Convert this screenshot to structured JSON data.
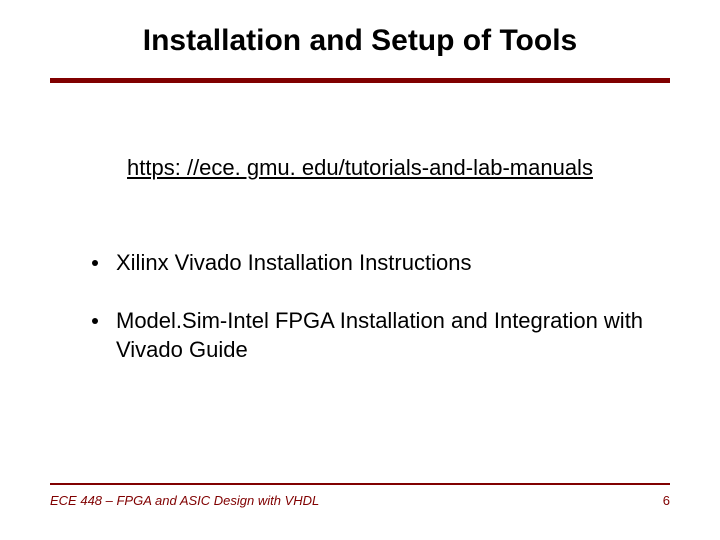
{
  "title": "Installation and Setup of Tools",
  "link": "https: //ece. gmu. edu/tutorials-and-lab-manuals",
  "bullets": [
    "Xilinx Vivado Installation Instructions",
    "Model.Sim-Intel FPGA Installation and Integration with Vivado Guide"
  ],
  "footer": "ECE 448 – FPGA and ASIC Design with VHDL",
  "page": "6"
}
